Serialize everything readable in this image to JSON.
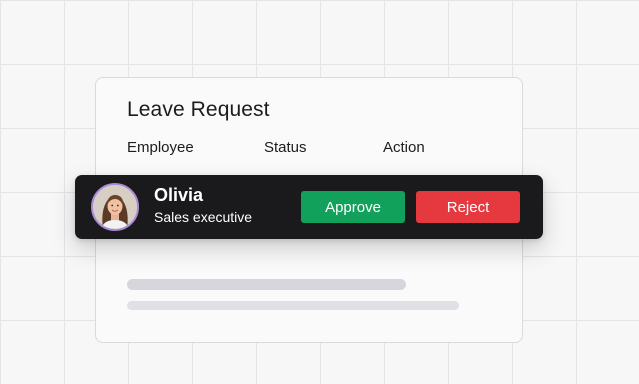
{
  "card": {
    "title": "Leave Request",
    "columns": [
      "Employee",
      "Status",
      "Action"
    ]
  },
  "row": {
    "name": "Olivia",
    "role": "Sales executive",
    "approve_label": "Approve",
    "reject_label": "Reject"
  },
  "colors": {
    "approve": "#12a15a",
    "reject": "#e5393f",
    "row_background": "#1a1a1c",
    "avatar_ring": "#a98ad6"
  },
  "icons": {
    "avatar": "user-avatar-photo"
  }
}
